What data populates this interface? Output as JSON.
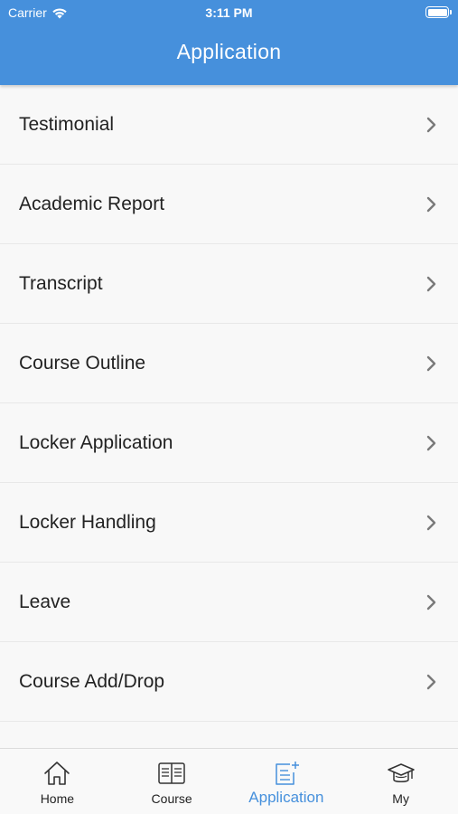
{
  "status_bar": {
    "carrier": "Carrier",
    "time": "3:11 PM"
  },
  "nav": {
    "title": "Application"
  },
  "menu": [
    {
      "label": "Testimonial"
    },
    {
      "label": "Academic Report"
    },
    {
      "label": "Transcript"
    },
    {
      "label": "Course Outline"
    },
    {
      "label": "Locker Application"
    },
    {
      "label": "Locker Handling"
    },
    {
      "label": "Leave"
    },
    {
      "label": "Course Add/Drop"
    }
  ],
  "tabbar": {
    "active": "Application",
    "tabs": [
      {
        "label": "Home",
        "icon": "home-icon"
      },
      {
        "label": "Course",
        "icon": "book-icon"
      },
      {
        "label": "Application",
        "icon": "application-icon"
      },
      {
        "label": "My",
        "icon": "graduation-cap-icon"
      }
    ]
  },
  "colors": {
    "accent": "#4690dc",
    "background": "#f8f8f8",
    "text": "#222222"
  }
}
